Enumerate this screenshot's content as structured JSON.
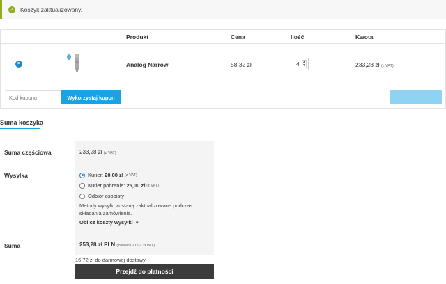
{
  "notice": {
    "message": "Koszyk zaktualizowany."
  },
  "table": {
    "headers": {
      "product": "Produkt",
      "price": "Cena",
      "quantity": "Ilość",
      "subtotal": "Kwota"
    },
    "rows": [
      {
        "remove": "×",
        "name": "Analog Narrow",
        "price": "58,32 zł",
        "quantity": "4",
        "subtotal": "233,28 zł",
        "vat": "(z VAT)"
      }
    ]
  },
  "coupon": {
    "placeholder": "Kod kuponu",
    "apply_label": "Wykorzystaj kupon"
  },
  "totals": {
    "title": "Suma koszyka",
    "subtotal_label": "Suma częściowa",
    "subtotal_value": "233,28 zł",
    "subtotal_vat": "(z VAT)",
    "shipping_label": "Wysyłka",
    "shipping_options": [
      {
        "label": "Kurier:",
        "price": "20,00 zł",
        "vat": "(z VAT)",
        "selected": true
      },
      {
        "label": "Kurier pobranie:",
        "price": "25,00 zł",
        "vat": "(z VAT)",
        "selected": false
      },
      {
        "label": "Odbiór osobisty",
        "price": "",
        "vat": "",
        "selected": false
      }
    ],
    "shipping_note": "Metody wysyłki zostaną zaktualizowane podczas składania zamówienia.",
    "calculate_label": "Oblicz koszty wysyłki",
    "total_label": "Suma",
    "total_value": "253,28 zł PLN",
    "total_vat_note": "(zawiera 21,02 zł VAT)",
    "free_shipping_note": "16,72 zł do darmowej dostawy",
    "checkout_label": "Przejdź do płatności"
  },
  "colors": {
    "accent": "#1aa3e0",
    "success": "#8fae1b",
    "dark_button": "#3b3b3b"
  }
}
